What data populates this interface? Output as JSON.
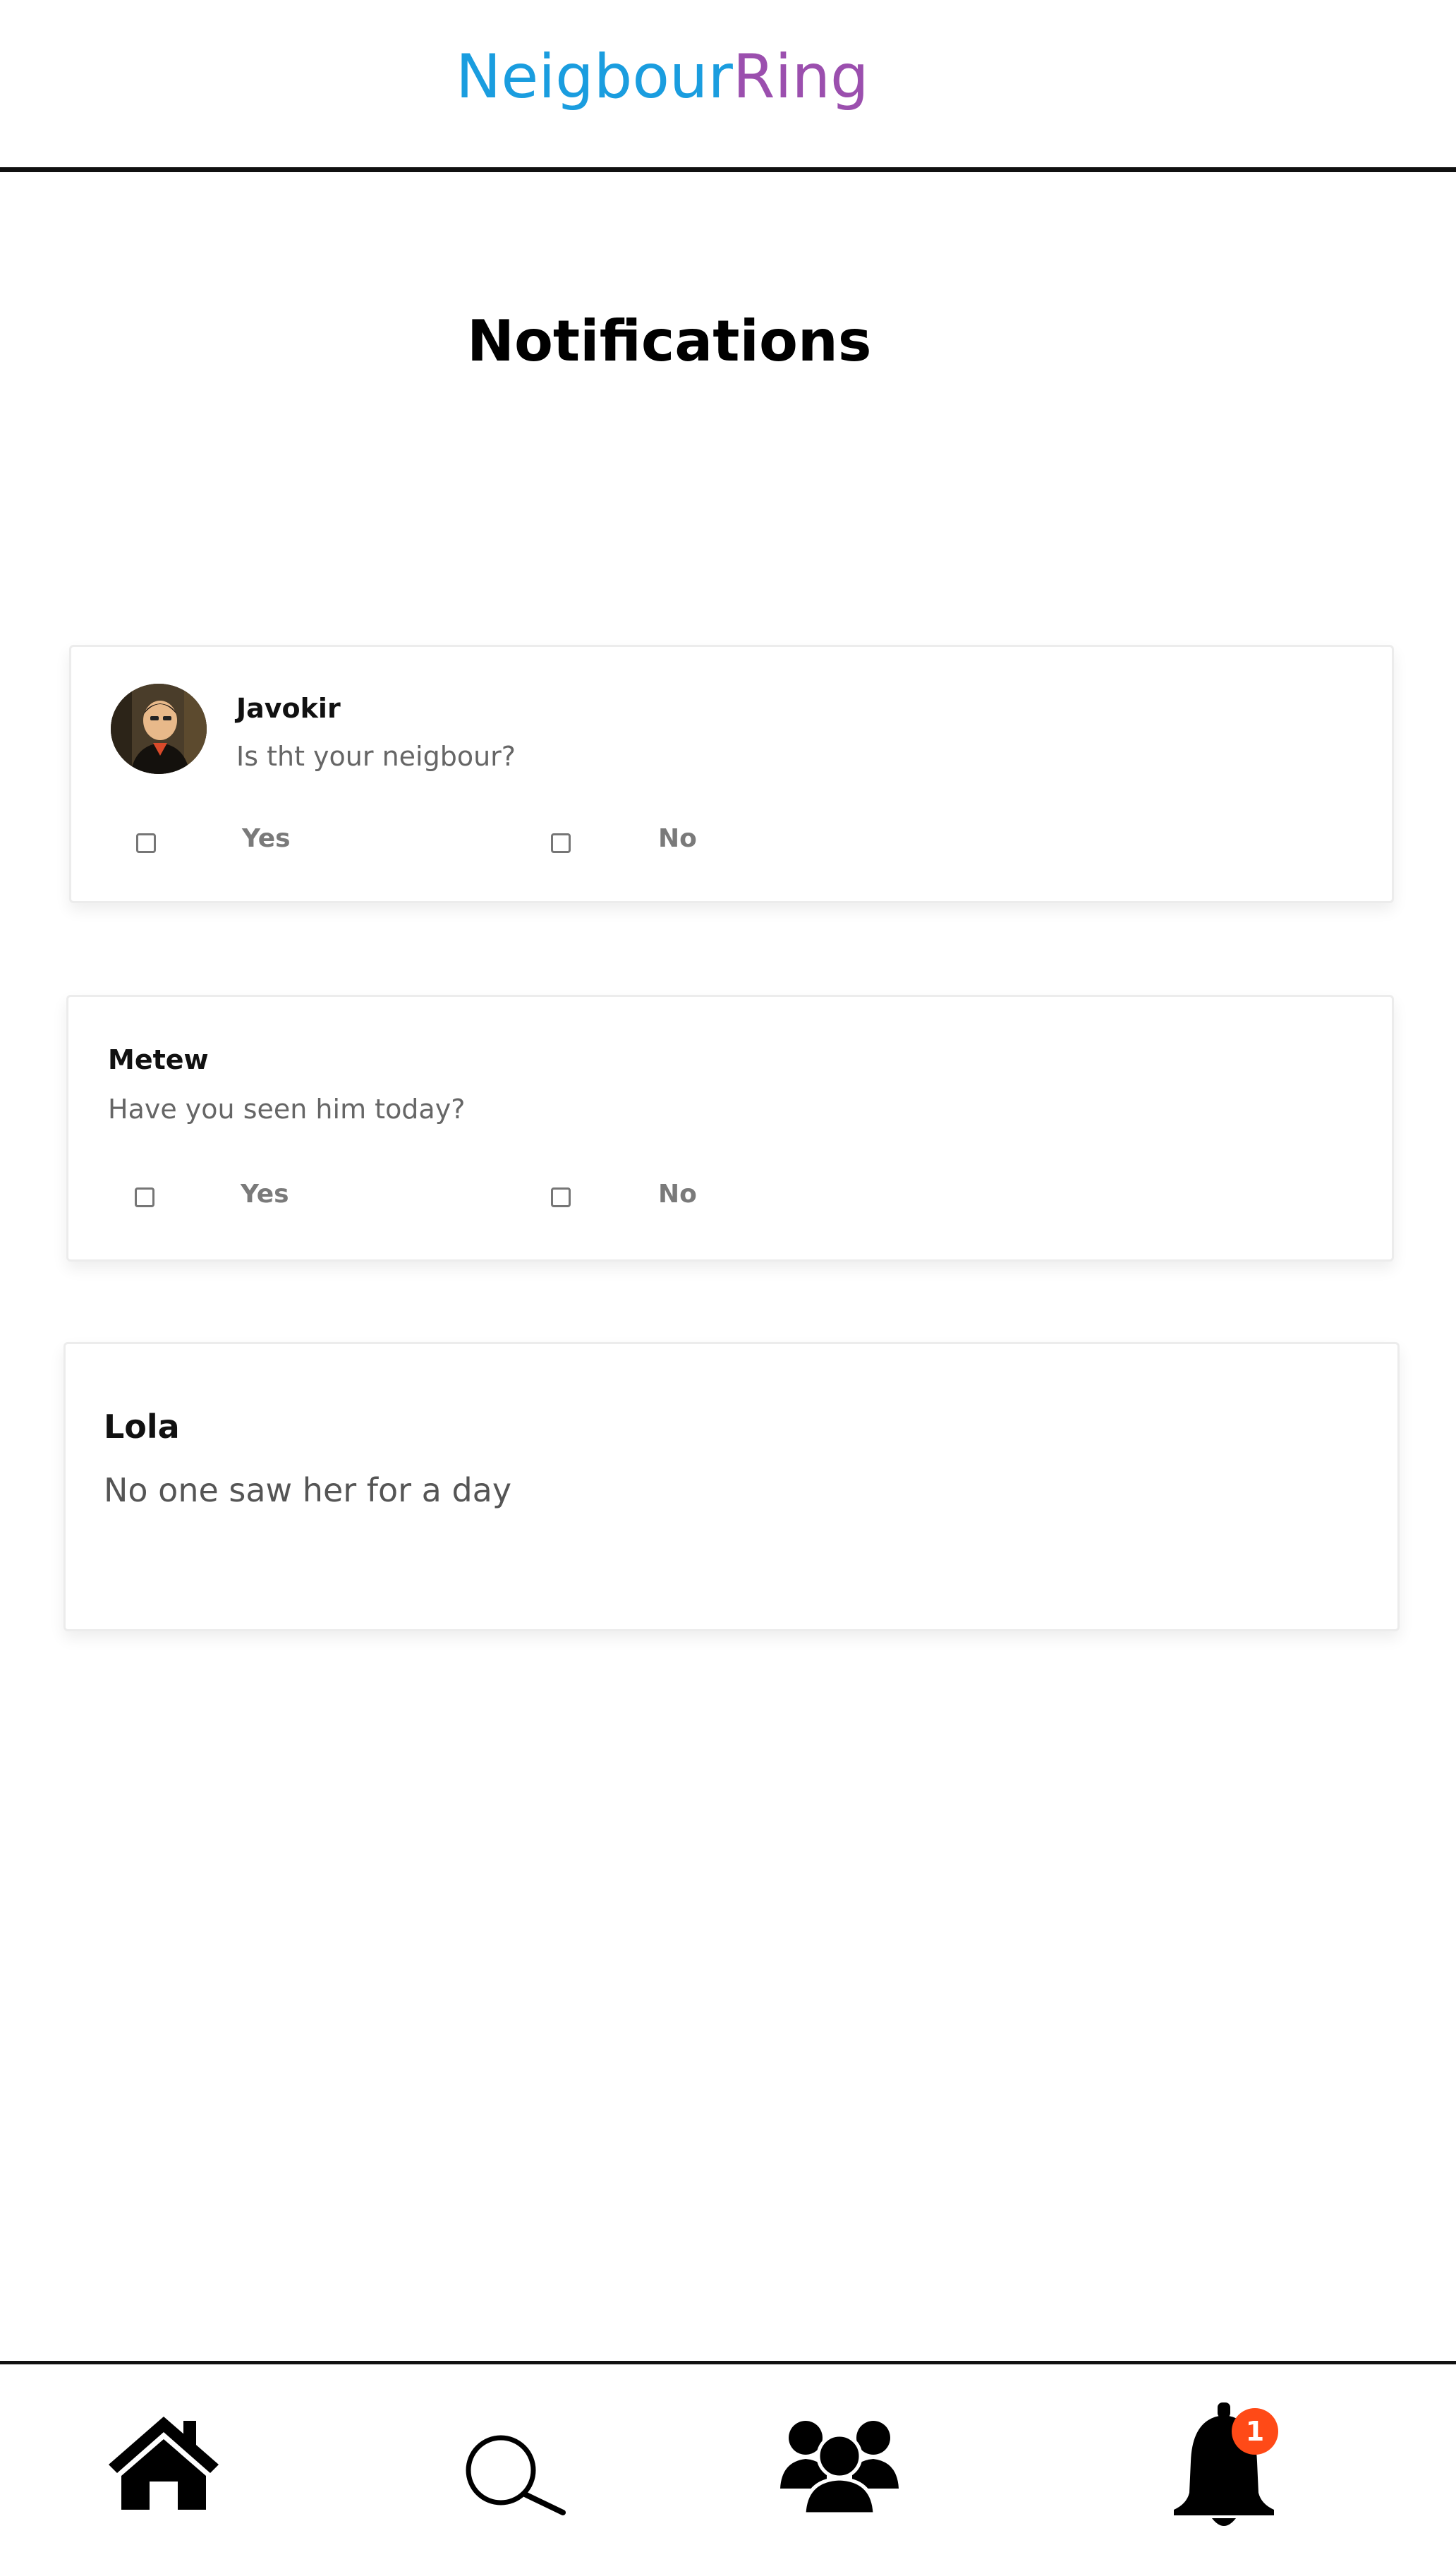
{
  "header": {
    "brand_part_a": "Neigbour",
    "brand_part_b": "Ring",
    "brand_colors": {
      "part_a": "#1a9ddf",
      "part_b": "#9b4fae"
    }
  },
  "page": {
    "title": "Notifications"
  },
  "notifications": [
    {
      "sender": "Javokir",
      "message": "Is tht your neigbour?",
      "has_avatar": true,
      "options": [
        {
          "label": "Yes",
          "checked": false
        },
        {
          "label": "No",
          "checked": false
        }
      ]
    },
    {
      "sender": "Metew",
      "message": "Have you seen him today?",
      "has_avatar": false,
      "options": [
        {
          "label": "Yes",
          "checked": false
        },
        {
          "label": "No",
          "checked": false
        }
      ]
    },
    {
      "sender": "Lola",
      "message": "No one saw her for a day",
      "has_avatar": false,
      "options": []
    }
  ],
  "bottom_nav": {
    "items": [
      {
        "icon": "home-icon"
      },
      {
        "icon": "search-icon"
      },
      {
        "icon": "group-icon"
      },
      {
        "icon": "bell-icon",
        "badge_count": "1",
        "badge_color": "#ff4a17"
      }
    ]
  }
}
